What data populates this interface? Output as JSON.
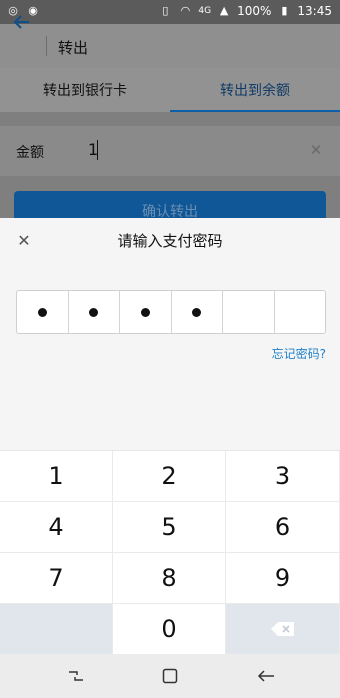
{
  "status_bar": {
    "left_icons": [
      "account-icon",
      "alert-icon"
    ],
    "network": "4G",
    "battery": "100%",
    "time": "13:45"
  },
  "app_bar": {
    "title": "转出"
  },
  "tabs": [
    {
      "label": "转出到银行卡",
      "active": false
    },
    {
      "label": "转出到余额",
      "active": true
    }
  ],
  "form": {
    "amount_label": "金额",
    "amount_value": "1",
    "confirm_label": "确认转出"
  },
  "dialog": {
    "title": "请输入支付密码",
    "pin_filled": 4,
    "pin_length": 6,
    "forgot_label": "忘记密码?"
  },
  "keypad": {
    "keys": [
      "1",
      "2",
      "3",
      "4",
      "5",
      "6",
      "7",
      "8",
      "9",
      "",
      "0",
      "backspace"
    ]
  },
  "colors": {
    "accent": "#0f5796",
    "link": "#1e7fc8"
  }
}
